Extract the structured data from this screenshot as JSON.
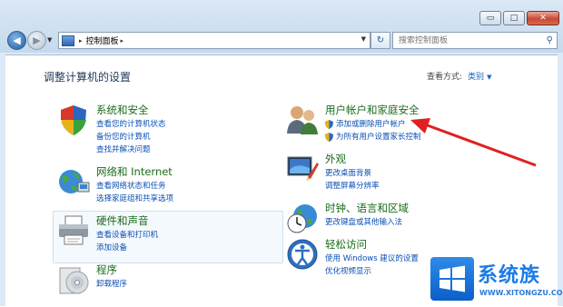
{
  "window": {
    "caption": {
      "minimize": "▭",
      "maximize": "□",
      "close": "✕"
    }
  },
  "nav": {
    "back": "◀",
    "forward": "▶",
    "address": {
      "crumb": "控制面板",
      "separator": "▸",
      "trailing_separator": "▸"
    },
    "refresh": "↻",
    "search_placeholder": "搜索控制面板",
    "search_icon": "magnifier-icon"
  },
  "main": {
    "title": "调整计算机的设置",
    "view_by": {
      "label": "查看方式:",
      "value": "类别",
      "arrow": "▼"
    }
  },
  "categories": [
    {
      "title": "系统和安全",
      "icon": "security-shield-icon",
      "links": [
        "查看您的计算机状态",
        "备份您的计算机",
        "查找并解决问题"
      ]
    },
    {
      "title": "网络和 Internet",
      "icon": "network-globe-icon",
      "links": [
        "查看网络状态和任务",
        "选择家庭组和共享选项"
      ]
    },
    {
      "title": "硬件和声音",
      "icon": "printer-icon",
      "links": [
        "查看设备和打印机",
        "添加设备"
      ]
    },
    {
      "title": "程序",
      "icon": "programs-disc-icon",
      "links": [
        "卸载程序"
      ]
    },
    {
      "title": "用户帐户和家庭安全",
      "icon": "users-icon",
      "links": [
        "添加或删除用户帐户",
        "为所有用户设置家长控制"
      ]
    },
    {
      "title": "外观",
      "icon": "appearance-icon",
      "links": [
        "更改桌面背景",
        "调整屏幕分辨率"
      ]
    },
    {
      "title": "时钟、语言和区域",
      "icon": "clock-globe-icon",
      "links": [
        "更改键盘或其他输入法"
      ]
    },
    {
      "title": "轻松访问",
      "icon": "ease-of-access-icon",
      "links": [
        "使用 Windows 建议的设置",
        "优化视频显示"
      ]
    }
  ],
  "watermark": {
    "brand": "系统族",
    "url": "WWW.XITONGZU.COM"
  },
  "colors": {
    "title_green": "#1a6b1a",
    "link_blue": "#0a4fb5",
    "arrow_red": "#e02020"
  }
}
